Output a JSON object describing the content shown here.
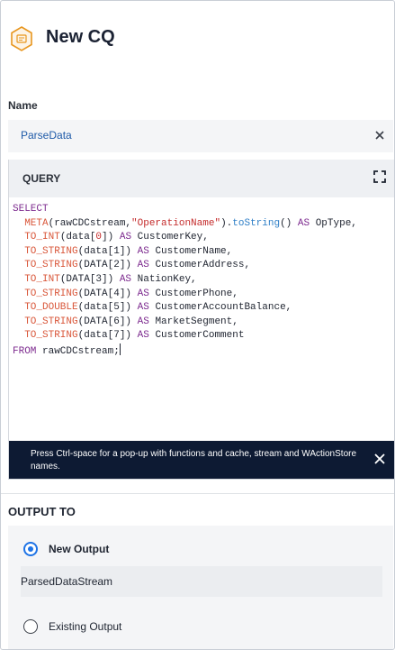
{
  "header": {
    "title": "New CQ",
    "icon": "cq-hexagon-icon",
    "accent_color": "#e8961e"
  },
  "name": {
    "label": "Name",
    "value": "ParseData",
    "clear_icon": "close-icon"
  },
  "query": {
    "title": "QUERY",
    "expand_icon": "expand-icon",
    "code_tokens": [
      {
        "t": "SELECT",
        "c": "kw"
      },
      {
        "t": "\n  "
      },
      {
        "t": "META",
        "c": "fn"
      },
      {
        "t": "(rawCDCstream,"
      },
      {
        "t": "\"OperationName\"",
        "c": "str"
      },
      {
        "t": ")."
      },
      {
        "t": "toString",
        "c": "mth"
      },
      {
        "t": "() "
      },
      {
        "t": "AS",
        "c": "kw"
      },
      {
        "t": " OpType,\n  "
      },
      {
        "t": "TO_INT",
        "c": "fn"
      },
      {
        "t": "(data["
      },
      {
        "t": "0",
        "c": "num"
      },
      {
        "t": "]) "
      },
      {
        "t": "AS",
        "c": "kw"
      },
      {
        "t": " CustomerKey,\n  "
      },
      {
        "t": "TO_STRING",
        "c": "fn"
      },
      {
        "t": "(data[1]) "
      },
      {
        "t": "AS",
        "c": "kw"
      },
      {
        "t": " CustomerName,\n  "
      },
      {
        "t": "TO_STRING",
        "c": "fn"
      },
      {
        "t": "(DATA[2]) "
      },
      {
        "t": "AS",
        "c": "kw"
      },
      {
        "t": " CustomerAddress,\n  "
      },
      {
        "t": "TO_INT",
        "c": "fn"
      },
      {
        "t": "(DATA[3]) "
      },
      {
        "t": "AS",
        "c": "kw"
      },
      {
        "t": " NationKey,\n  "
      },
      {
        "t": "TO_STRING",
        "c": "fn"
      },
      {
        "t": "(DATA[4]) "
      },
      {
        "t": "AS",
        "c": "kw"
      },
      {
        "t": " CustomerPhone,\n  "
      },
      {
        "t": "TO_DOUBLE",
        "c": "fn"
      },
      {
        "t": "(data[5]) "
      },
      {
        "t": "AS",
        "c": "kw"
      },
      {
        "t": " CustomerAccountBalance,\n  "
      },
      {
        "t": "TO_STRING",
        "c": "fn"
      },
      {
        "t": "(DATA[6]) "
      },
      {
        "t": "AS",
        "c": "kw"
      },
      {
        "t": " MarketSegment,\n  "
      },
      {
        "t": "TO_STRING",
        "c": "fn"
      },
      {
        "t": "(data[7]) "
      },
      {
        "t": "AS",
        "c": "kw"
      },
      {
        "t": " CustomerComment\n"
      },
      {
        "t": "FROM",
        "c": "kw"
      },
      {
        "t": " rawCDCstream;"
      }
    ],
    "hint": "Press Ctrl-space for a pop-up with functions and cache, stream and WActionStore names.",
    "hint_close_icon": "close-icon"
  },
  "output": {
    "label": "OUTPUT TO",
    "options": [
      {
        "label": "New Output",
        "selected": true
      },
      {
        "label": "Existing Output",
        "selected": false
      }
    ],
    "stream_value": "ParsedDataStream"
  }
}
